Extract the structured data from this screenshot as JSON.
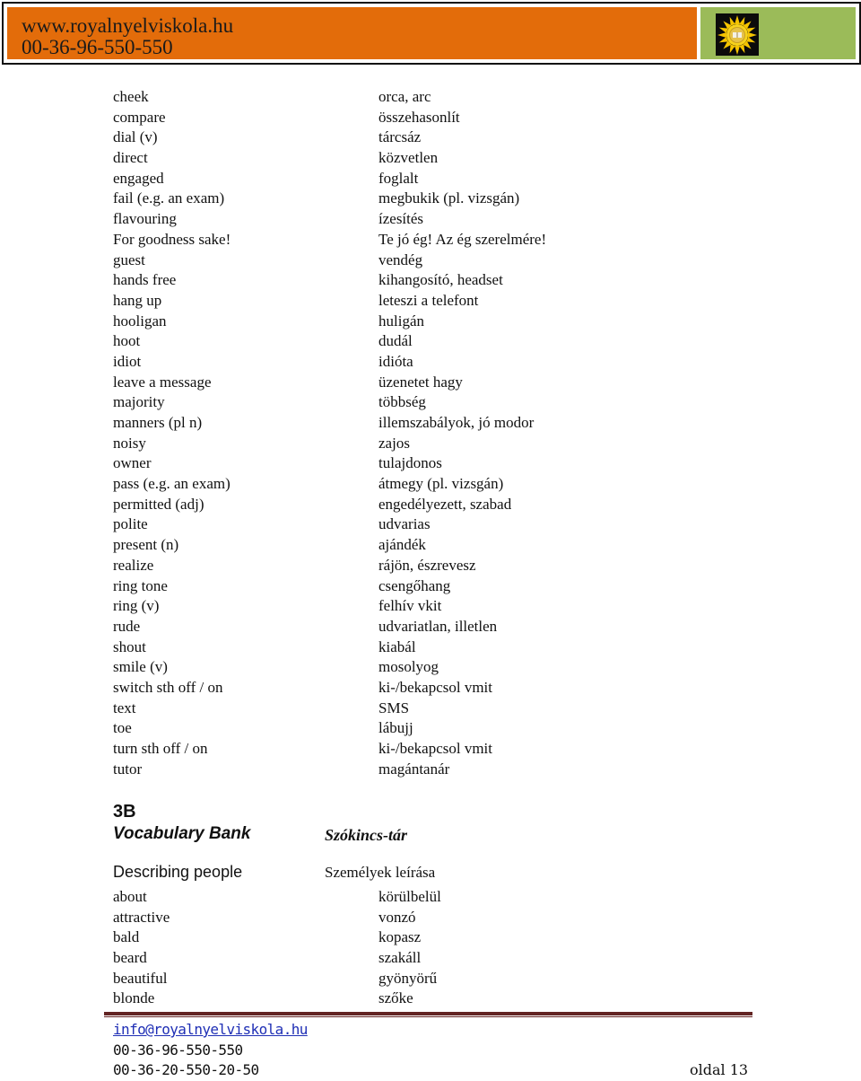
{
  "header": {
    "website": "www.royalnyelviskola.hu",
    "phone": "00-36-96-550-550",
    "logo_icon": "sun-book-logo-icon",
    "colors": {
      "orange": "#e36c0a",
      "green": "#9bbb59"
    }
  },
  "vocab_list_1": [
    {
      "en": "cheek",
      "hu": "orca, arc"
    },
    {
      "en": "compare",
      "hu": "összehasonlít"
    },
    {
      "en": "dial (v)",
      "hu": "tárcsáz"
    },
    {
      "en": "direct",
      "hu": "közvetlen"
    },
    {
      "en": "engaged",
      "hu": "foglalt"
    },
    {
      "en": "fail (e.g. an exam)",
      "hu": "megbukik (pl. vizsgán)"
    },
    {
      "en": "flavouring",
      "hu": "ízesítés"
    },
    {
      "en": "For goodness sake!",
      "hu": "Te jó ég! Az ég szerelmére!"
    },
    {
      "en": "guest",
      "hu": "vendég"
    },
    {
      "en": "hands free",
      "hu": "kihangosító, headset"
    },
    {
      "en": "hang up",
      "hu": "leteszi a telefont"
    },
    {
      "en": "hooligan",
      "hu": "huligán"
    },
    {
      "en": "hoot",
      "hu": "dudál"
    },
    {
      "en": "idiot",
      "hu": "idióta"
    },
    {
      "en": "leave a message",
      "hu": "üzenetet hagy"
    },
    {
      "en": "majority",
      "hu": "többség"
    },
    {
      "en": "manners (pl n)",
      "hu": "illemszabályok, jó modor"
    },
    {
      "en": "noisy",
      "hu": "zajos"
    },
    {
      "en": "owner",
      "hu": "tulajdonos"
    },
    {
      "en": "pass (e.g. an exam)",
      "hu": "átmegy (pl. vizsgán)"
    },
    {
      "en": "permitted (adj)",
      "hu": "engedélyezett, szabad"
    },
    {
      "en": "polite",
      "hu": "udvarias"
    },
    {
      "en": "present  (n)",
      "hu": "ajándék"
    },
    {
      "en": "realize",
      "hu": "rájön, észrevesz"
    },
    {
      "en": "ring tone",
      "hu": "csengőhang"
    },
    {
      "en": "ring (v)",
      "hu": "felhív vkit"
    },
    {
      "en": "rude",
      "hu": "udvariatlan, illetlen"
    },
    {
      "en": "shout",
      "hu": "kiabál"
    },
    {
      "en": "smile (v)",
      "hu": "mosolyog"
    },
    {
      "en": "switch sth off / on",
      "hu": "ki-/bekapcsol vmit"
    },
    {
      "en": "text",
      "hu": "SMS"
    },
    {
      "en": "toe",
      "hu": "lábujj"
    },
    {
      "en": "turn sth off / on",
      "hu": "ki-/bekapcsol vmit"
    },
    {
      "en": "tutor",
      "hu": "magántanár"
    }
  ],
  "section": {
    "number": "3B",
    "title_en": "Vocabulary Bank",
    "title_hu": "Szókincs-tár",
    "subtitle_en": "Describing people",
    "subtitle_hu": "Személyek leírása"
  },
  "vocab_list_2": [
    {
      "en": "about",
      "hu": "körülbelül"
    },
    {
      "en": "attractive",
      "hu": "vonzó"
    },
    {
      "en": "bald",
      "hu": "kopasz"
    },
    {
      "en": "beard",
      "hu": "szakáll"
    },
    {
      "en": "beautiful",
      "hu": "gyönyörű"
    },
    {
      "en": "blonde",
      "hu": "szőke"
    }
  ],
  "footer": {
    "email": "info@royalnyelviskola.hu",
    "phone_1": "00-36-96-550-550",
    "phone_2": "00-36-20-550-20-50",
    "page_label": "oldal 13",
    "rule_color": "#632423"
  }
}
